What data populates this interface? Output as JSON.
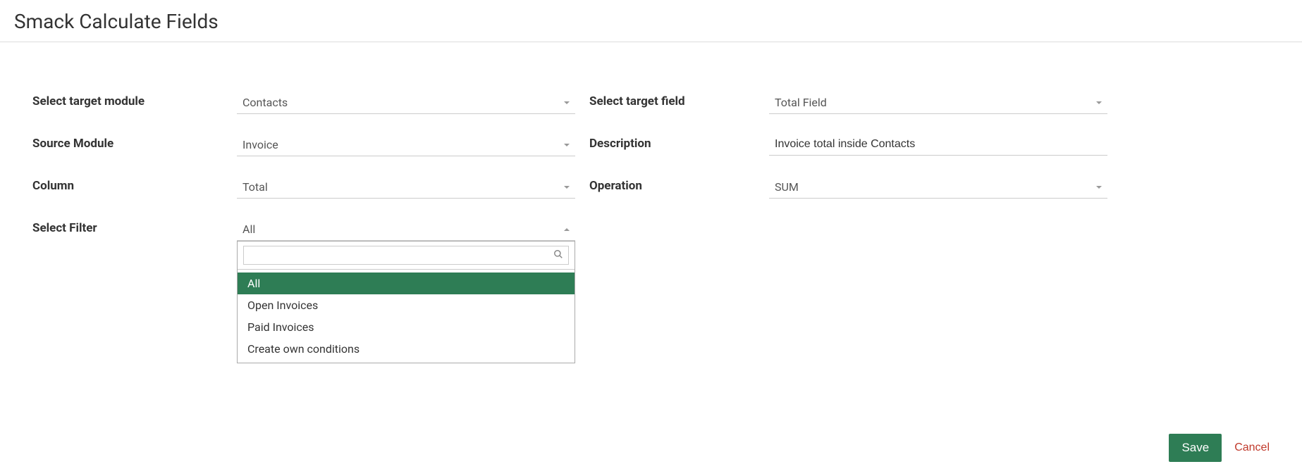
{
  "page": {
    "title": "Smack Calculate Fields"
  },
  "labels": {
    "target_module": "Select target module",
    "source_module": "Source Module",
    "column": "Column",
    "select_filter": "Select Filter",
    "target_field": "Select target field",
    "description": "Description",
    "operation": "Operation"
  },
  "values": {
    "target_module": "Contacts",
    "source_module": "Invoice",
    "column": "Total",
    "select_filter": "All",
    "target_field": "Total Field",
    "description": "Invoice total inside Contacts",
    "operation": "SUM"
  },
  "filter_dropdown": {
    "search_value": "",
    "options": [
      "All",
      "Open Invoices",
      "Paid Invoices",
      "Create own conditions"
    ]
  },
  "actions": {
    "save": "Save",
    "cancel": "Cancel"
  },
  "colors": {
    "accent": "#2e7d55",
    "danger": "#c0392b"
  }
}
